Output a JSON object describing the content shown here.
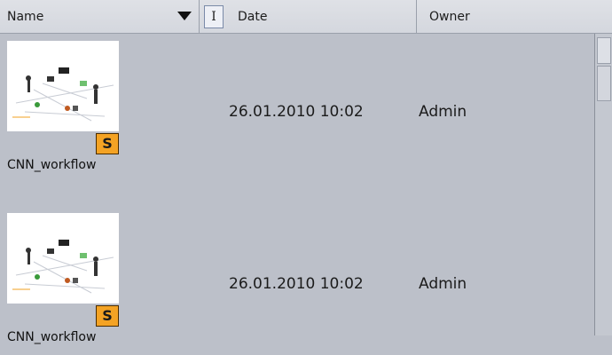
{
  "header": {
    "name_label": "Name",
    "sort_icon": "triangle-down-icon",
    "resize_glyph": "I",
    "date_label": "Date",
    "owner_label": "Owner"
  },
  "rows": [
    {
      "name": "CNN_workflow",
      "badge": "S",
      "date": "26.01.2010 10:02",
      "owner": "Admin"
    },
    {
      "name": "CNN_workflow",
      "badge": "S",
      "date": "26.01.2010 10:02",
      "owner": "Admin"
    }
  ],
  "colors": {
    "background": "#bcc0c9",
    "badge": "#f4a324"
  }
}
